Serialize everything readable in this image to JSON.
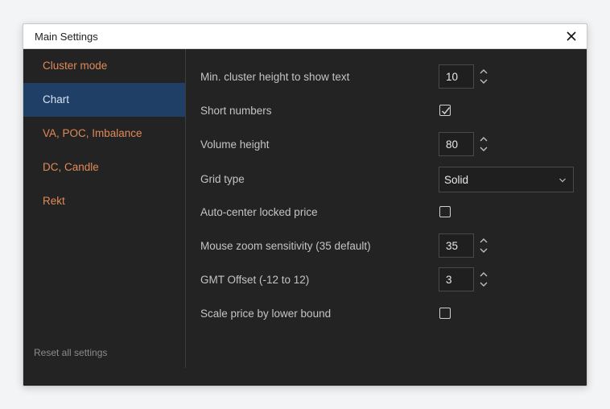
{
  "dialog": {
    "title": "Main Settings",
    "close_icon": "close-icon"
  },
  "sidebar": {
    "items": [
      {
        "label": "Cluster mode",
        "active": false
      },
      {
        "label": "Chart",
        "active": true
      },
      {
        "label": "VA, POC, Imbalance",
        "active": false
      },
      {
        "label": "DC, Candle",
        "active": false
      },
      {
        "label": "Rekt",
        "active": false
      }
    ],
    "reset_label": "Reset all settings"
  },
  "settings": {
    "min_cluster_height": {
      "label": "Min. cluster height to show text",
      "value": "10"
    },
    "short_numbers": {
      "label": "Short numbers",
      "checked": true
    },
    "volume_height": {
      "label": "Volume height",
      "value": "80"
    },
    "grid_type": {
      "label": "Grid type",
      "value": "Solid"
    },
    "auto_center": {
      "label": "Auto-center locked price",
      "checked": false
    },
    "mouse_zoom": {
      "label": "Mouse zoom sensitivity (35 default)",
      "value": "35"
    },
    "gmt_offset": {
      "label": "GMT Offset (-12 to 12)",
      "value": "3"
    },
    "scale_price": {
      "label": "Scale price by lower bound",
      "checked": false
    }
  },
  "colors": {
    "accent_orange": "#e08a5a",
    "active_nav_bg": "#203f66",
    "panel_bg": "#232323"
  }
}
